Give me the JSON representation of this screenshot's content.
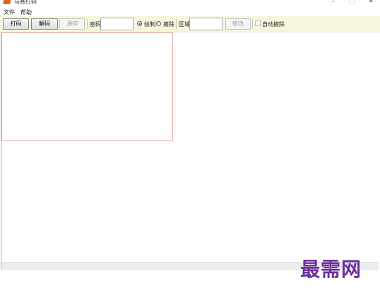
{
  "window": {
    "title": "马赛打码",
    "minimize_glyph": "–",
    "maximize_glyph": "□",
    "close_glyph": "✕"
  },
  "menu": {
    "file": "文件",
    "help": "帮助"
  },
  "toolbar": {
    "encode_label": "打码",
    "decode_label": "解码",
    "save_label": "保存",
    "password_label": "密码",
    "password_value": "",
    "draw_label": "绘制",
    "erase_label": "擦除",
    "region_label": "区域",
    "region_value": "",
    "modify_label": "修改",
    "auto_erase_label": "自动擦除",
    "mode_selected": "draw",
    "auto_erase_checked": false
  },
  "watermark": "最需网",
  "colors": {
    "toolbar_bg": "#f5f6dc",
    "canvas_border": "#f0a8a8",
    "watermark": "#6b2fa0",
    "app_icon": "#e0621d"
  }
}
